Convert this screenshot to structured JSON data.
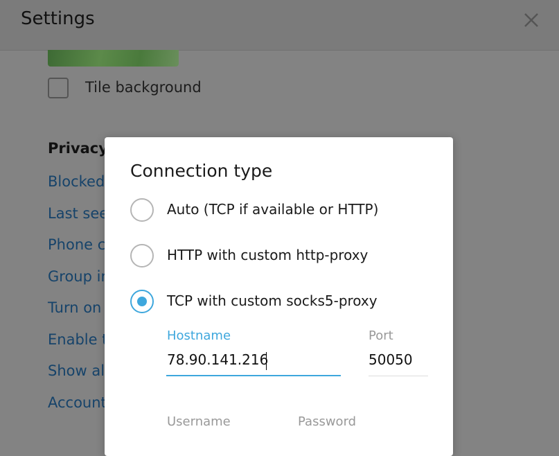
{
  "header": {
    "title": "Settings",
    "close_icon": "close-icon"
  },
  "chat_background": {
    "tile_label": "Tile background"
  },
  "privacy": {
    "title": "Privacy",
    "items": [
      {
        "label": "Blocked"
      },
      {
        "label": "Last see"
      },
      {
        "label": "Phone c"
      },
      {
        "label": "Group in"
      },
      {
        "label": "Turn on"
      },
      {
        "label": "Enable t"
      },
      {
        "label": "Show al"
      },
      {
        "label": "Account"
      }
    ]
  },
  "dialog": {
    "title": "Connection type",
    "options": [
      {
        "label": "Auto (TCP if available or HTTP)",
        "selected": false
      },
      {
        "label": "HTTP with custom http-proxy",
        "selected": false
      },
      {
        "label": "TCP with custom socks5-proxy",
        "selected": true
      }
    ],
    "hostname": {
      "label": "Hostname",
      "value": "78.90.141.216"
    },
    "port": {
      "label": "Port",
      "value": "50050"
    },
    "username": {
      "label": "Username"
    },
    "password": {
      "label": "Password"
    }
  },
  "colors": {
    "accent": "#3ea7dd",
    "link": "#16436a",
    "overlay_bg": "#838383"
  }
}
